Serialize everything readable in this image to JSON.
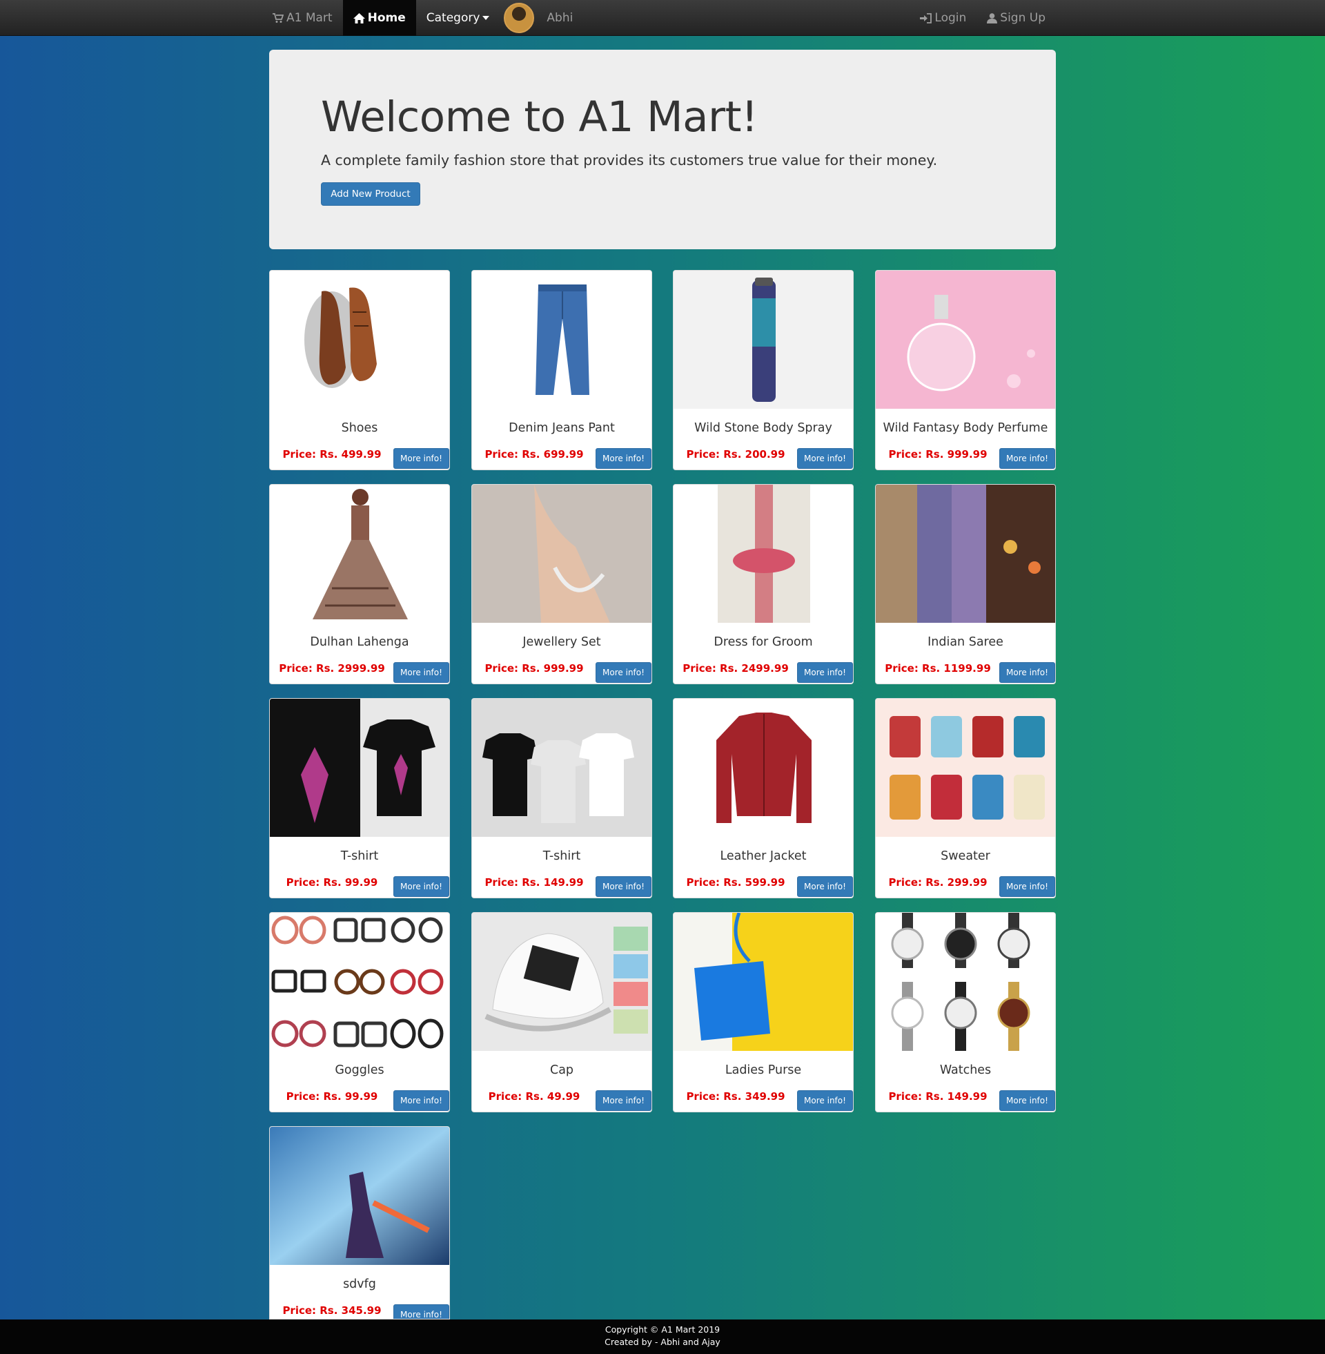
{
  "nav": {
    "brand": "A1 Mart",
    "home": "Home",
    "category": "Category",
    "user": "Abhi",
    "login": "Login",
    "signup": "Sign Up"
  },
  "jumbotron": {
    "title": "Welcome to A1 Mart!",
    "subtitle": "A complete family fashion store that provides its customers true value for their money.",
    "button": "Add New Product"
  },
  "more_label": "More info!",
  "products": [
    {
      "name": "Shoes",
      "price": "Price: Rs. 499.99"
    },
    {
      "name": "Denim Jeans Pant",
      "price": "Price: Rs. 699.99"
    },
    {
      "name": "Wild Stone Body Spray",
      "price": "Price: Rs. 200.99"
    },
    {
      "name": "Wild Fantasy Body Perfume",
      "price": "Price: Rs. 999.99"
    },
    {
      "name": "Dulhan Lahenga",
      "price": "Price: Rs. 2999.99"
    },
    {
      "name": "Jewellery Set",
      "price": "Price: Rs. 999.99"
    },
    {
      "name": "Dress for Groom",
      "price": "Price: Rs. 2499.99"
    },
    {
      "name": "Indian Saree",
      "price": "Price: Rs. 1199.99"
    },
    {
      "name": "T-shirt",
      "price": "Price: Rs. 99.99"
    },
    {
      "name": "T-shirt",
      "price": "Price: Rs. 149.99"
    },
    {
      "name": "Leather Jacket",
      "price": "Price: Rs. 599.99"
    },
    {
      "name": "Sweater",
      "price": "Price: Rs. 299.99"
    },
    {
      "name": "Goggles",
      "price": "Price: Rs. 99.99"
    },
    {
      "name": "Cap",
      "price": "Price: Rs. 49.99"
    },
    {
      "name": "Ladies Purse",
      "price": "Price: Rs. 349.99"
    },
    {
      "name": "Watches",
      "price": "Price: Rs. 149.99"
    },
    {
      "name": "sdvfg",
      "price": "Price: Rs. 345.99"
    }
  ],
  "footer": {
    "copyright": "Copyright © A1 Mart 2019",
    "credits": "Created by - Abhi and Ajay"
  },
  "colors": {
    "primary_button": "#337ab7",
    "price_red": "#e00000",
    "navbar": "#222222"
  }
}
